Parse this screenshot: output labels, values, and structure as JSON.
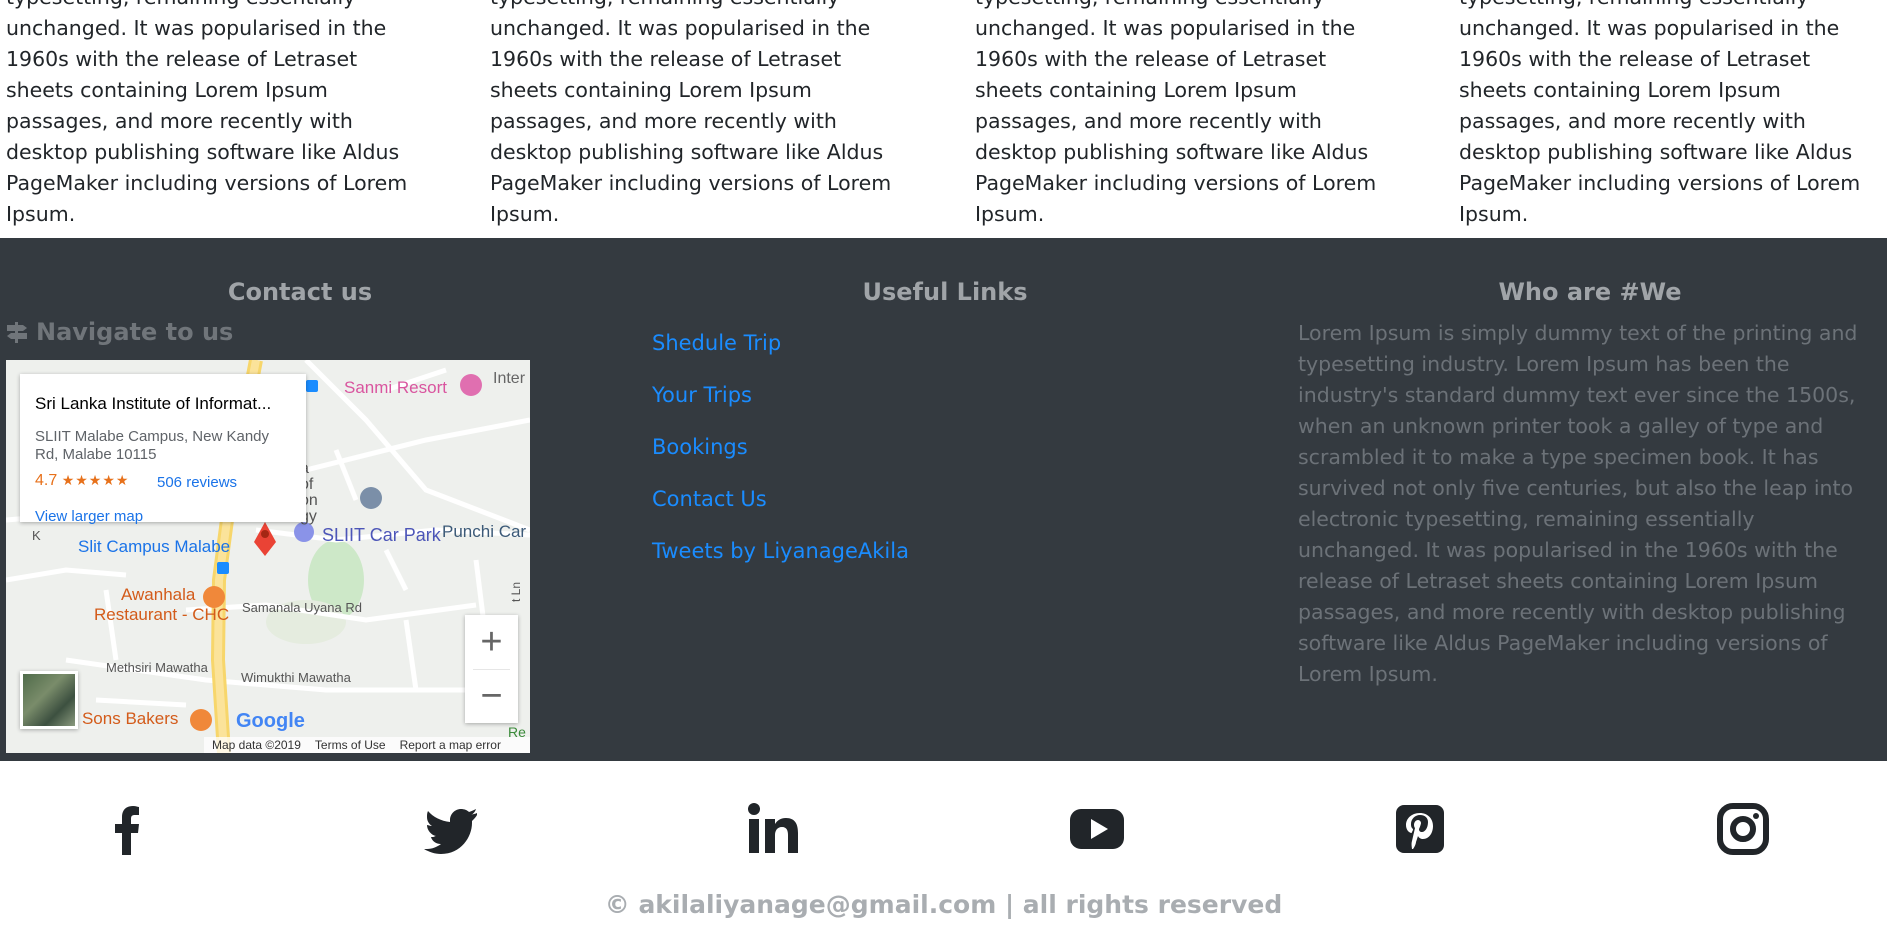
{
  "top_columns": [
    {
      "text": "typesetting, remaining essentially unchanged. It was popularised in the 1960s with the release of Letraset sheets containing Lorem Ipsum passages, and more recently with desktop publishing software like Aldus PageMaker including versions of Lorem Ipsum."
    },
    {
      "text": "typesetting, remaining essentially unchanged. It was popularised in the 1960s with the release of Letraset sheets containing Lorem Ipsum passages, and more recently with desktop publishing software like Aldus PageMaker including versions of Lorem Ipsum."
    },
    {
      "text": "typesetting, remaining essentially unchanged. It was popularised in the 1960s with the release of Letraset sheets containing Lorem Ipsum passages, and more recently with desktop publishing software like Aldus PageMaker including versions of Lorem Ipsum."
    },
    {
      "text": "typesetting, remaining essentially unchanged. It was popularised in the 1960s with the release of Letraset sheets containing Lorem Ipsum passages, and more recently with desktop publishing software like Aldus PageMaker including versions of Lorem Ipsum."
    }
  ],
  "footer": {
    "contact_title": "Contact us",
    "navigate_title": "Navigate to us",
    "links_title": "Useful Links",
    "links": [
      "Shedule Trip",
      "Your Trips",
      "Bookings",
      "Contact Us",
      "Tweets by LiyanageAkila"
    ],
    "who_title": "Who are #We",
    "who_text": "Lorem Ipsum is simply dummy text of the printing and typesetting industry. Lorem Ipsum has been the industry's standard dummy text ever since the 1500s, when an unknown printer took a galley of type and scrambled it to make a type specimen book. It has survived not only five centuries, but also the leap into electronic typesetting, remaining essentially unchanged. It was popularised in the 1960s with the release of Letraset sheets containing Lorem Ipsum passages, and more recently with desktop publishing software like Aldus PageMaker including versions of Lorem Ipsum."
  },
  "map": {
    "place_name": "Sri Lanka Institute of Informat...",
    "address": "SLIIT Malabe Campus, New Kandy Rd, Malabe 10115",
    "rating": "4.7",
    "stars": "★★★★★",
    "reviews": "506 reviews",
    "larger_map": "View larger map",
    "labels": {
      "sanmi": "Sanmi Resort",
      "inter": "Inter",
      "car_park": "SLIIT Car Park",
      "punchi": "Punchi Car",
      "slit_campus": "Slit Campus Malabe",
      "awanhala": "Awanhala",
      "restaurant": "Restaurant - CHC",
      "samanala": "Samanala Uyana Rd",
      "methsiri": "Methsiri Mawatha",
      "wimukthi": "Wimukthi Mawatha",
      "don": "Don & Sons Bakers",
      "frag_a": "a",
      "frag_of": "of",
      "frag_on": "on",
      "frag_gy": "gy",
      "frag_k": "K",
      "frag_ln": "t Ln",
      "frag_re": "Re"
    },
    "zoom_in": "+",
    "zoom_out": "−",
    "google": "Google",
    "map_data": "Map data ©2019",
    "terms": "Terms of Use",
    "report": "Report a map error"
  },
  "social": [
    "facebook-icon",
    "twitter-icon",
    "linkedin-icon",
    "youtube-icon",
    "pinterest-icon",
    "instagram-icon"
  ],
  "copyright": "© akilaliyanage@gmail.com | all rights reserved",
  "colors": {
    "footer_bg": "#343a40",
    "link": "#1a8cff",
    "muted": "#a0a4a8"
  }
}
